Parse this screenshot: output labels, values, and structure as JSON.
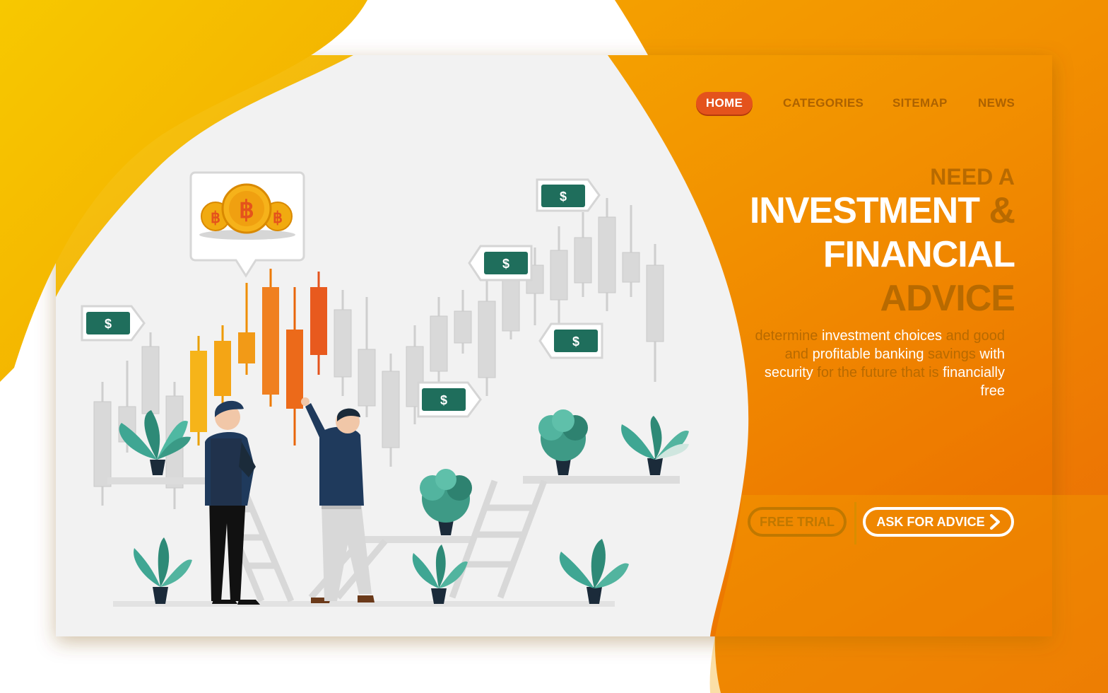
{
  "nav": {
    "home": "HOME",
    "categories": "CATEGORIES",
    "sitemap": "SITEMAP",
    "news": "NEWS"
  },
  "hero": {
    "line1": "NEED A",
    "line2": "INVESTMENT",
    "amp": "&",
    "line3": "FINANCIAL",
    "line4": "ADVICE"
  },
  "description": {
    "p1": "determine ",
    "p2": "investment choices",
    "p3": " and good and ",
    "p4": "profitable banking",
    "p5": " savings ",
    "p6": "with security",
    "p7": " for the future that is ",
    "p8": "financially free"
  },
  "buttons": {
    "free_trial": "FREE TRIAL",
    "ask_advice": "ASK FOR ADVICE"
  },
  "colors": {
    "orange_dark": "#e4531c",
    "orange_mid": "#f28a00",
    "yellow": "#f7c200",
    "accent_brown": "#b86a00",
    "card_bg": "#f1f1f1",
    "plant_teal": "#3fa693",
    "dollar_green": "#1f6e5c"
  },
  "icons": {
    "coin": "bitcoin-coin-icon",
    "bill": "dollar-bill-icon",
    "chevron": "chevron-right-icon"
  }
}
